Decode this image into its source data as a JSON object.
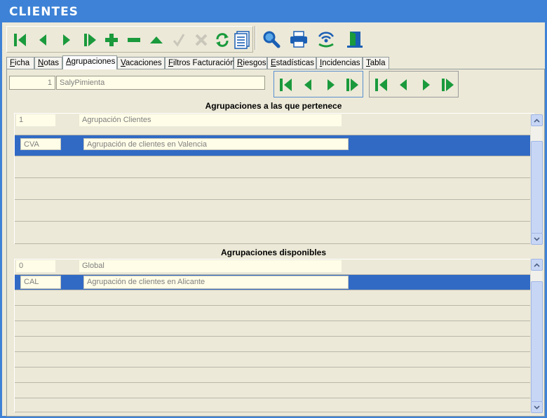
{
  "window": {
    "title": "CLIENTES"
  },
  "toolbar": {
    "buttons": [
      {
        "name": "first-record-icon"
      },
      {
        "name": "previous-record-icon"
      },
      {
        "name": "next-record-icon"
      },
      {
        "name": "last-record-icon"
      },
      {
        "name": "add-record-icon"
      },
      {
        "name": "delete-record-icon"
      },
      {
        "name": "edit-record-icon"
      },
      {
        "name": "confirm-icon"
      },
      {
        "name": "cancel-icon"
      },
      {
        "name": "refresh-icon"
      },
      {
        "name": "list-view-icon"
      }
    ],
    "tools": [
      {
        "name": "search-icon"
      },
      {
        "name": "print-icon"
      },
      {
        "name": "wireless-icon"
      },
      {
        "name": "exit-door-icon"
      }
    ]
  },
  "tabs": [
    {
      "label": "Ficha",
      "underline": "F",
      "rest": "icha"
    },
    {
      "label": "Notas",
      "underline": "N",
      "rest": "otas"
    },
    {
      "label": "Agrupaciones",
      "underline": "A",
      "rest": "grupaciones",
      "active": true
    },
    {
      "label": "Vacaciones",
      "underline": "V",
      "rest": "acaciones"
    },
    {
      "label": "Filtros Facturación",
      "underline": "F",
      "rest": "iltros Facturación"
    },
    {
      "label": "Riesgos",
      "underline": "R",
      "rest": "iesgos"
    },
    {
      "label": "Estadísticas",
      "underline": "E",
      "rest": "stadísticas"
    },
    {
      "label": "Incidencias",
      "underline": "I",
      "rest": "ncidencias"
    },
    {
      "label": "Tabla",
      "underline": "T",
      "rest": "abla"
    }
  ],
  "client": {
    "code": "1",
    "name": "SalyPimienta"
  },
  "member_section": {
    "title": "Agrupaciones a las que pertenece",
    "header_row": {
      "code": "1",
      "name": "Agrupación Clientes"
    },
    "selected_row": {
      "code": "CVA",
      "name": "Agrupación  de clientes en Valencia"
    }
  },
  "available_section": {
    "title": "Agrupaciones disponibles",
    "header_row": {
      "code": "0",
      "name": "Global"
    },
    "selected_row": {
      "code": "CAL",
      "name": "Agrupación de clientes en Alicante"
    }
  },
  "colors": {
    "accent": "#3d82d6",
    "selection": "#316ac5",
    "icon_green": "#1a9a3c",
    "icon_blue": "#1a5fb4"
  }
}
